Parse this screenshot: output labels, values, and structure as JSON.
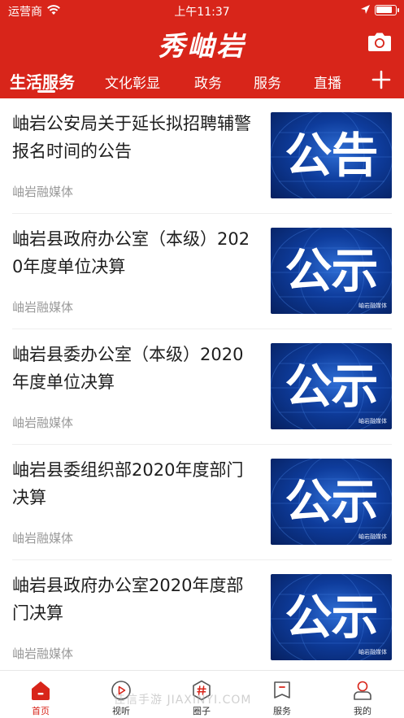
{
  "status_bar": {
    "carrier": "运营商",
    "time": "上午11:37",
    "battery_level": 0.85
  },
  "header": {
    "logo_text": "秀岫岩",
    "icons": {
      "camera": "camera-icon",
      "add": "plus-icon"
    }
  },
  "tabs": [
    {
      "label": "生活服务",
      "active": true
    },
    {
      "label": "文化彰显",
      "active": false
    },
    {
      "label": "政务",
      "active": false
    },
    {
      "label": "服务",
      "active": false
    },
    {
      "label": "直播",
      "active": false
    }
  ],
  "articles": [
    {
      "title": "岫岩公安局关于延长拟招聘辅警报名时间的公告",
      "source": "岫岩融媒体",
      "thumb_text": "公告",
      "thumb_mark": ""
    },
    {
      "title": "岫岩县政府办公室（本级）2020年度单位决算",
      "source": "岫岩融媒体",
      "thumb_text": "公示",
      "thumb_mark": "岫岩融媒体"
    },
    {
      "title": "岫岩县委办公室（本级）2020年度单位决算",
      "source": "岫岩融媒体",
      "thumb_text": "公示",
      "thumb_mark": "岫岩融媒体"
    },
    {
      "title": "岫岩县委组织部2020年度部门决算",
      "source": "岫岩融媒体",
      "thumb_text": "公示",
      "thumb_mark": "岫岩融媒体"
    },
    {
      "title": "岫岩县政府办公室2020年度部门决算",
      "source": "岫岩融媒体",
      "thumb_text": "公示",
      "thumb_mark": "岫岩融媒体"
    }
  ],
  "tabbar": [
    {
      "label": "首页",
      "icon": "home-icon",
      "active": true
    },
    {
      "label": "视听",
      "icon": "play-icon",
      "active": false
    },
    {
      "label": "圈子",
      "icon": "hashtag-icon",
      "active": false
    },
    {
      "label": "服务",
      "icon": "service-icon",
      "active": false
    },
    {
      "label": "我的",
      "icon": "profile-icon",
      "active": false
    }
  ],
  "watermark": "佳信手游 JIAXINYI.COM",
  "colors": {
    "brand_red": "#d8251a",
    "source_gray": "#9a9a9a",
    "thumb_blue": "#0e3c9c"
  }
}
